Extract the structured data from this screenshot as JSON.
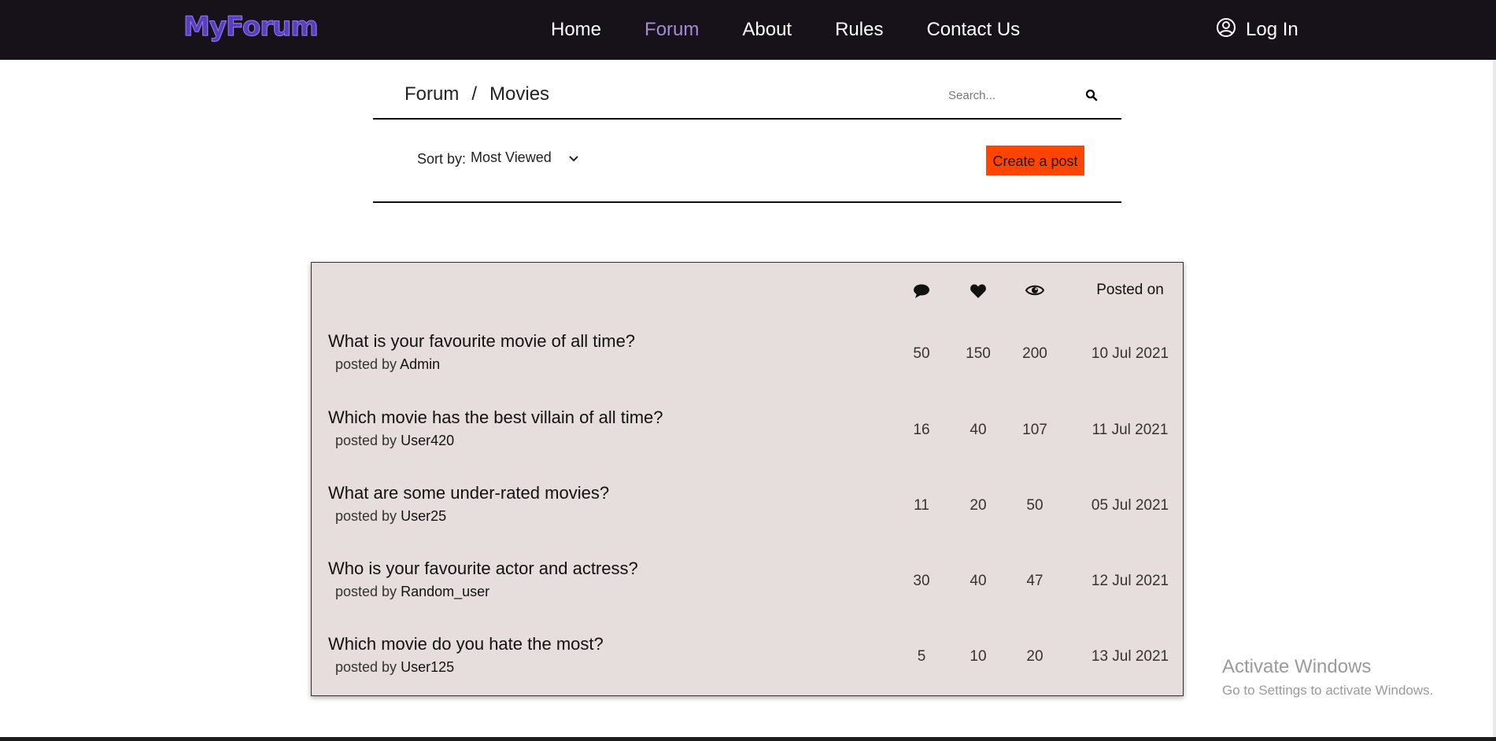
{
  "brand": {
    "logo_text": "MyForum",
    "color": "#5a3fb8"
  },
  "nav": {
    "items": [
      {
        "label": "Home",
        "active": false
      },
      {
        "label": "Forum",
        "active": true
      },
      {
        "label": "About",
        "active": false
      },
      {
        "label": "Rules",
        "active": false
      },
      {
        "label": "Contact Us",
        "active": false
      }
    ],
    "login_label": "Log In",
    "active_color": "#a58ad6",
    "background": "#17111a"
  },
  "breadcrumb": {
    "root": "Forum",
    "separator": "/",
    "current": "Movies"
  },
  "search": {
    "placeholder": "Search...",
    "icon": "search-icon"
  },
  "sort": {
    "label": "Sort by:",
    "selected": "Most Viewed"
  },
  "create_post": {
    "label": "Create a post",
    "color": "#ff4500"
  },
  "table": {
    "headers": {
      "comments_icon": "comment-icon",
      "likes_icon": "heart-icon",
      "views_icon": "eye-icon",
      "posted_on": "Posted on"
    },
    "posted_by_prefix": "posted by",
    "rows": [
      {
        "title": "What is your favourite movie of all time?",
        "author": "Admin",
        "comments": "50",
        "likes": "150",
        "views": "200",
        "date": "10 Jul 2021"
      },
      {
        "title": "Which movie has the best villain of all time?",
        "author": "User420",
        "comments": "16",
        "likes": "40",
        "views": "107",
        "date": "11 Jul 2021"
      },
      {
        "title": "What are some under-rated movies?",
        "author": "User25",
        "comments": "11",
        "likes": "20",
        "views": "50",
        "date": "05 Jul 2021"
      },
      {
        "title": "Who is your favourite actor and actress?",
        "author": "Random_user",
        "comments": "30",
        "likes": "40",
        "views": "47",
        "date": "12 Jul 2021"
      },
      {
        "title": "Which movie do you hate the most?",
        "author": "User125",
        "comments": "5",
        "likes": "10",
        "views": "20",
        "date": "13 Jul 2021"
      }
    ],
    "background": "#e6dedd"
  },
  "watermark": {
    "title": "Activate Windows",
    "subtitle": "Go to Settings to activate Windows."
  }
}
